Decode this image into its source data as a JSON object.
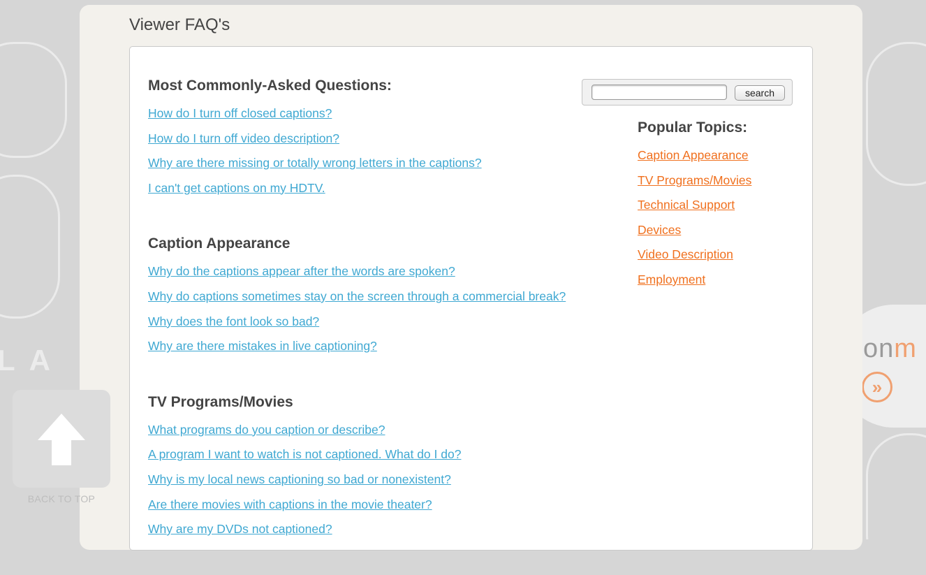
{
  "page": {
    "title": "Viewer FAQ's"
  },
  "search": {
    "placeholder": "",
    "button_label": "search"
  },
  "sections": [
    {
      "heading": "Most Commonly-Asked Questions:",
      "links": [
        "How do I turn off closed captions?",
        "How do I turn off video description?",
        "Why are there missing or totally wrong letters in the captions?",
        "I can't get captions on my HDTV."
      ]
    },
    {
      "heading": "Caption Appearance",
      "links": [
        "Why do the captions appear after the words are spoken?",
        "Why do captions sometimes stay on the screen through a commercial break?",
        "Why does the font look so bad?",
        "Why are there mistakes in live captioning?"
      ]
    },
    {
      "heading": "TV Programs/Movies",
      "links": [
        "What programs do you caption or describe?",
        "A program I want to watch is not captioned. What do I do?",
        "Why is my local news captioning so bad or nonexistent?",
        "Are there movies with captions in the movie theater?",
        "Why are my DVDs not captioned?"
      ]
    }
  ],
  "popular_topics": {
    "heading": "Popular Topics:",
    "links": [
      "Caption Appearance",
      "TV Programs/Movies",
      "Technical Support",
      "Devices",
      "Video Description",
      "Employment"
    ]
  },
  "back_to_top": {
    "label": "BACK TO TOP",
    "icon": "arrow-up-icon"
  },
  "background": {
    "letters": "LA",
    "brand_text_a": "on",
    "brand_text_b": "m",
    "brand_icon": "double-chevron-right-icon"
  },
  "colors": {
    "link": "#3fa8d2",
    "topic_link": "#f0701e",
    "heading": "#444444",
    "panel": "#f3f1ec"
  }
}
